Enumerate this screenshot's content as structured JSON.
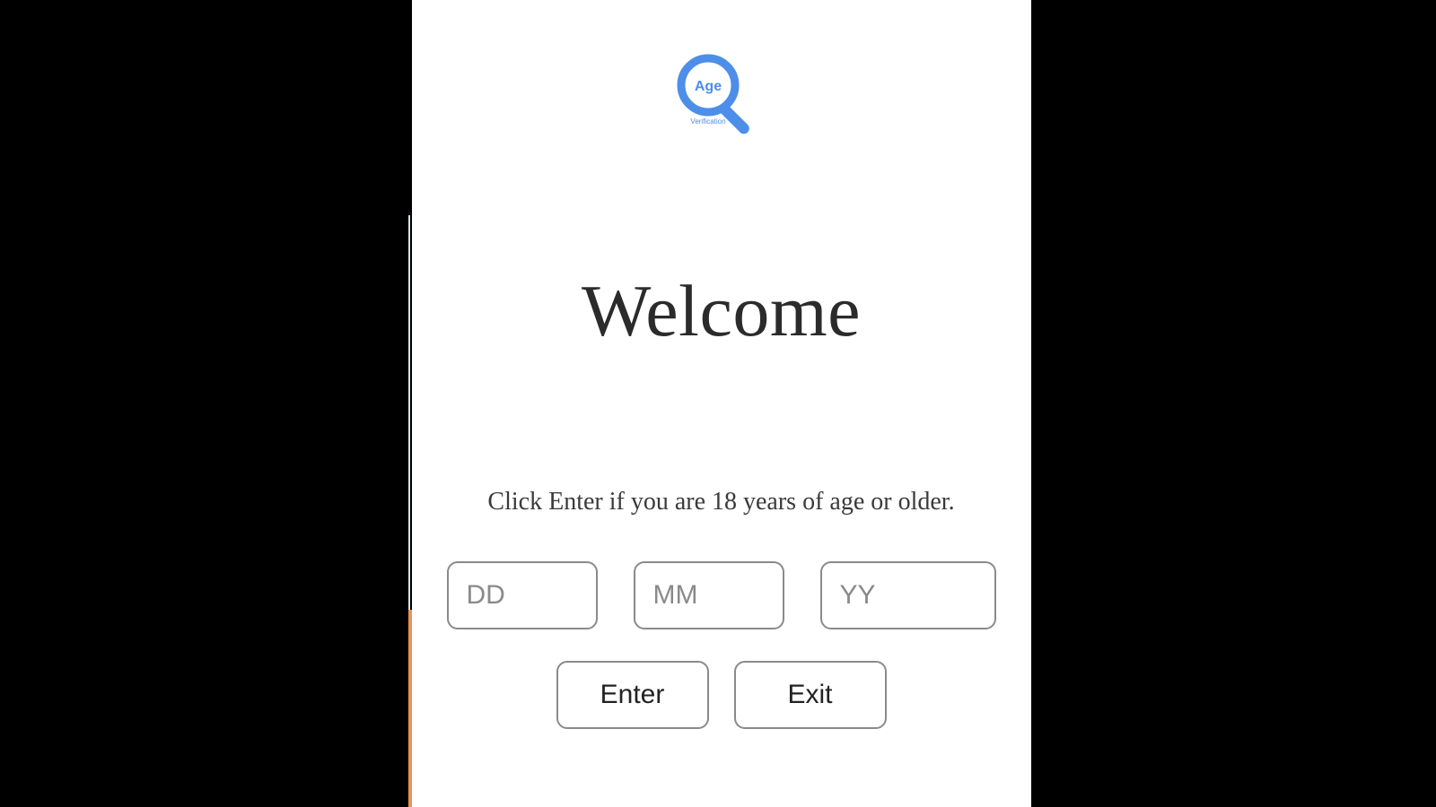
{
  "logo": {
    "text": "Age",
    "subtext": "Verification"
  },
  "heading": "Welcome",
  "subtitle": "Click Enter if you are 18 years of age or older.",
  "inputs": {
    "day_placeholder": "DD",
    "month_placeholder": "MM",
    "year_placeholder": "YY"
  },
  "buttons": {
    "enter": "Enter",
    "exit": "Exit"
  },
  "colors": {
    "accent_blue": "#4d8ee8",
    "border_gray": "#8a8a8a"
  }
}
